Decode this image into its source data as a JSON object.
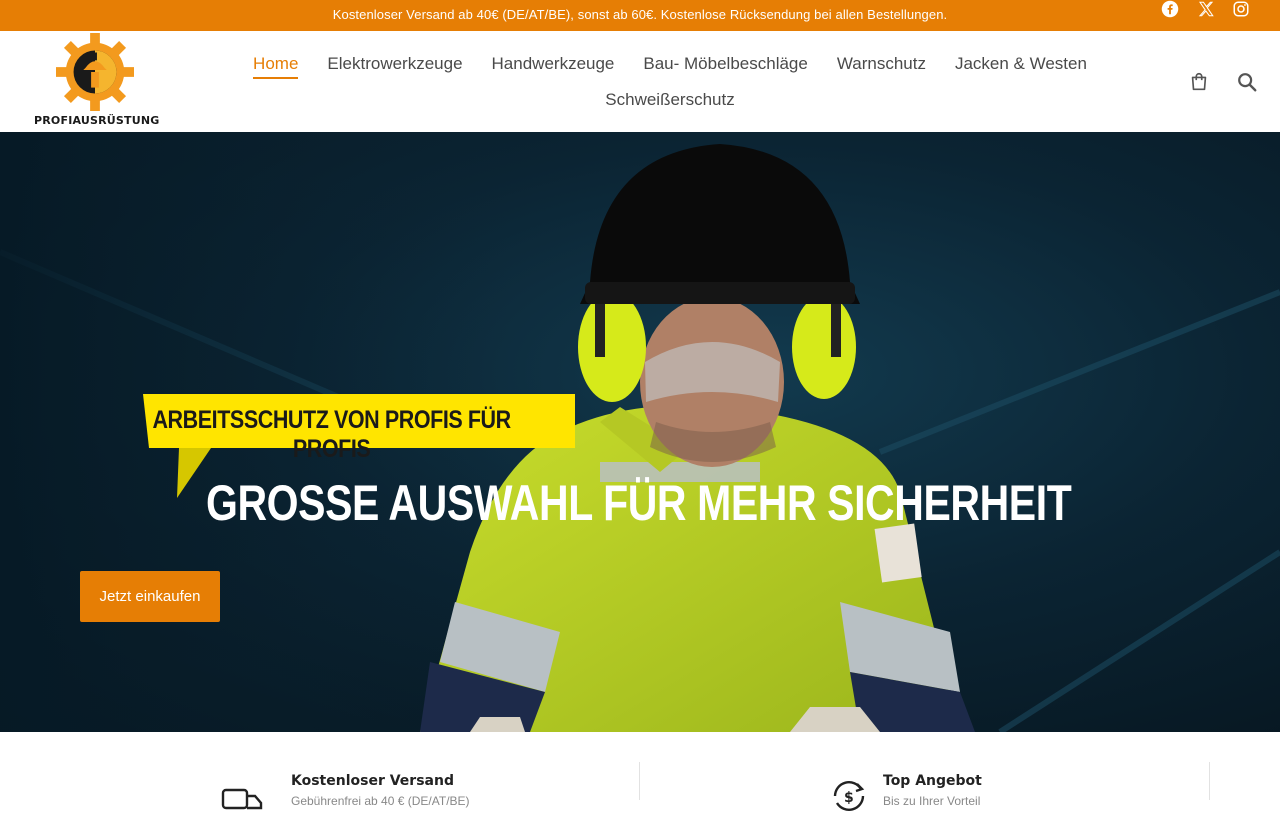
{
  "announcement": {
    "text": "Kostenloser Versand ab 40€ (DE/AT/BE), sonst ab 60€. Kostenlose Rücksendung bei allen Bestellungen."
  },
  "social": [
    {
      "name": "facebook-icon"
    },
    {
      "name": "x-icon"
    },
    {
      "name": "instagram-icon"
    }
  ],
  "brand": {
    "name": "PROFIAUSRÜSTUNG"
  },
  "nav": {
    "items": [
      {
        "label": "Home",
        "active": true
      },
      {
        "label": "Elektrowerkzeuge"
      },
      {
        "label": "Handwerkzeuge"
      },
      {
        "label": "Bau- Möbelbeschläge"
      },
      {
        "label": "Warnschutz"
      },
      {
        "label": "Jacken & Westen"
      },
      {
        "label": "Schweißerschutz"
      }
    ]
  },
  "hero": {
    "ribbon_text": "ARBEITSSCHUTZ VON PROFIS FÜR PROFIS",
    "headline": "GROSSE AUSWAHL FÜR MEHR SICHERHEIT",
    "cta_label": "Jetzt einkaufen"
  },
  "features": [
    {
      "title": "Kostenloser Versand",
      "subtitle": "Gebührenfrei ab 40 € (DE/AT/BE)",
      "icon": "delivery-truck-icon"
    },
    {
      "title": "Top Angebot",
      "subtitle": "Bis zu Ihrer Vorteil",
      "icon": "money-cycle-icon"
    }
  ],
  "colors": {
    "accent": "#e67e05",
    "ribbon": "#ffe500",
    "hero_bg": "#0b2433"
  }
}
